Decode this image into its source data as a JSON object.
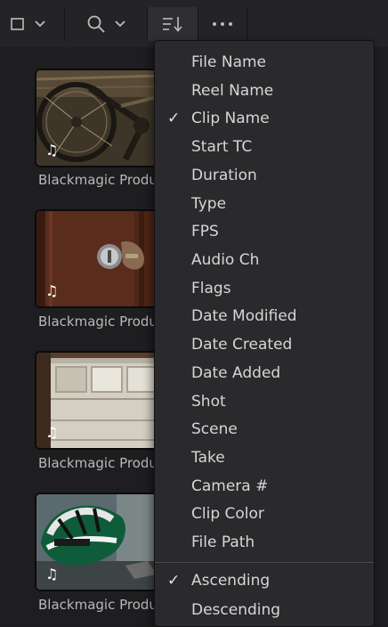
{
  "toolbar": {
    "icons": [
      "view-mode-icon",
      "chevron-down-icon",
      "search-icon",
      "chevron-down-icon",
      "sort-icon",
      "more-options-icon"
    ]
  },
  "clips": [
    {
      "name": "Blackmagic Production Camera",
      "thumb": "bicycle",
      "badge": "♫"
    },
    {
      "name": "Blackmagic Production Camera",
      "thumb": "door-lock",
      "badge": "♫"
    },
    {
      "name": "Blackmagic Production Camera",
      "thumb": "garage-door",
      "badge": "♫"
    },
    {
      "name": "Blackmagic Production Camera",
      "thumb": "helmet",
      "badge": "♫"
    }
  ],
  "sort_menu": {
    "fields": [
      {
        "label": "File Name",
        "checked": false
      },
      {
        "label": "Reel Name",
        "checked": false
      },
      {
        "label": "Clip Name",
        "checked": true
      },
      {
        "label": "Start TC",
        "checked": false
      },
      {
        "label": "Duration",
        "checked": false
      },
      {
        "label": "Type",
        "checked": false
      },
      {
        "label": "FPS",
        "checked": false
      },
      {
        "label": "Audio Ch",
        "checked": false
      },
      {
        "label": "Flags",
        "checked": false
      },
      {
        "label": "Date Modified",
        "checked": false
      },
      {
        "label": "Date Created",
        "checked": false
      },
      {
        "label": "Date Added",
        "checked": false
      },
      {
        "label": "Shot",
        "checked": false
      },
      {
        "label": "Scene",
        "checked": false
      },
      {
        "label": "Take",
        "checked": false
      },
      {
        "label": "Camera #",
        "checked": false
      },
      {
        "label": "Clip Color",
        "checked": false
      },
      {
        "label": "File Path",
        "checked": false
      }
    ],
    "order": [
      {
        "label": "Ascending",
        "checked": true
      },
      {
        "label": "Descending",
        "checked": false
      }
    ],
    "check_glyph": "✓"
  }
}
